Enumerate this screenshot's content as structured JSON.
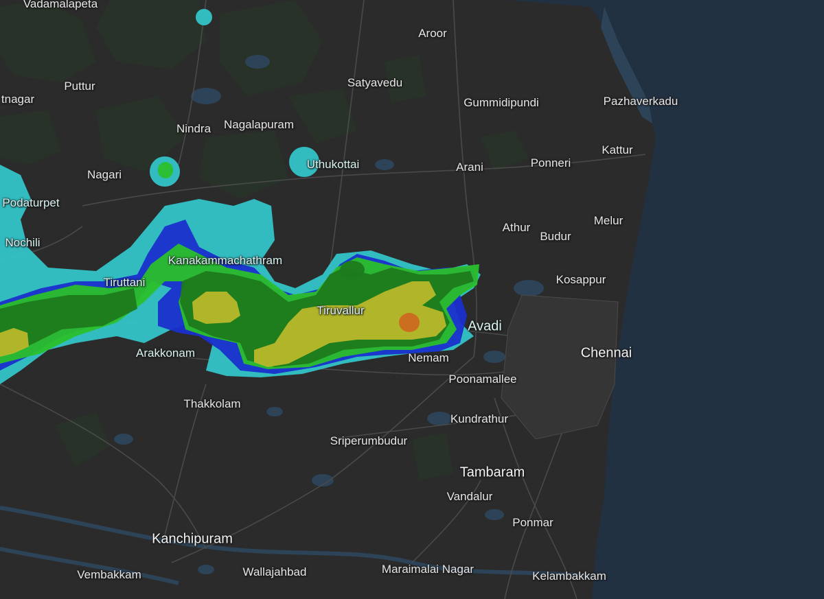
{
  "map": {
    "colors": {
      "land": "#2b2b2b",
      "sea": "#223142",
      "water": "#2d4358",
      "forest": "#283328",
      "road": "#4a4a4a",
      "radar_light": "#33c4c8",
      "radar_blue": "#1a2fcc",
      "radar_green": "#2bbf2b",
      "radar_dark_green": "#1e7a1e",
      "radar_yellow": "#b8b82a",
      "radar_orange": "#cc6a20"
    },
    "places": [
      {
        "id": "vadamalapeta",
        "name": "Vadamalapeta",
        "rank": "minor"
      },
      {
        "id": "aroor",
        "name": "Aroor",
        "rank": "minor"
      },
      {
        "id": "puttur",
        "name": "Puttur",
        "rank": "minor"
      },
      {
        "id": "satyavedu",
        "name": "Satyavedu",
        "rank": "minor"
      },
      {
        "id": "tnagar",
        "name": "tnagar",
        "rank": "minor"
      },
      {
        "id": "gummidipundi",
        "name": "Gummidipundi",
        "rank": "minor"
      },
      {
        "id": "pazhaverkadu",
        "name": "Pazhaverkadu",
        "rank": "minor"
      },
      {
        "id": "nindra",
        "name": "Nindra",
        "rank": "minor"
      },
      {
        "id": "nagalapuram",
        "name": "Nagalapuram",
        "rank": "minor"
      },
      {
        "id": "kattur",
        "name": "Kattur",
        "rank": "minor"
      },
      {
        "id": "uthukottai",
        "name": "Uthukottai",
        "rank": "minor"
      },
      {
        "id": "nagari",
        "name": "Nagari",
        "rank": "minor"
      },
      {
        "id": "arani",
        "name": "Arani",
        "rank": "minor"
      },
      {
        "id": "ponneri",
        "name": "Ponneri",
        "rank": "minor"
      },
      {
        "id": "podaturpet",
        "name": "Podaturpet",
        "rank": "minor"
      },
      {
        "id": "melur",
        "name": "Melur",
        "rank": "minor"
      },
      {
        "id": "athur",
        "name": "Athur",
        "rank": "minor"
      },
      {
        "id": "budur",
        "name": "Budur",
        "rank": "minor"
      },
      {
        "id": "nochili",
        "name": "Nochili",
        "rank": "minor"
      },
      {
        "id": "kanakammachathram",
        "name": "Kanakammachathram",
        "rank": "minor"
      },
      {
        "id": "kosappur",
        "name": "Kosappur",
        "rank": "minor"
      },
      {
        "id": "tiruttani",
        "name": "Tiruttani",
        "rank": "minor"
      },
      {
        "id": "tiruvallur",
        "name": "Tiruvallur",
        "rank": "minor"
      },
      {
        "id": "avadi",
        "name": "Avadi",
        "rank": "major"
      },
      {
        "id": "arakkonam",
        "name": "Arakkonam",
        "rank": "minor"
      },
      {
        "id": "chennai",
        "name": "Chennai",
        "rank": "major"
      },
      {
        "id": "nemam",
        "name": "Nemam",
        "rank": "minor"
      },
      {
        "id": "poonamallee",
        "name": "Poonamallee",
        "rank": "minor"
      },
      {
        "id": "thakkolam",
        "name": "Thakkolam",
        "rank": "minor"
      },
      {
        "id": "kundrathur",
        "name": "Kundrathur",
        "rank": "minor"
      },
      {
        "id": "sriperumbudur",
        "name": "Sriperumbudur",
        "rank": "minor"
      },
      {
        "id": "tambaram",
        "name": "Tambaram",
        "rank": "major"
      },
      {
        "id": "vandalur",
        "name": "Vandalur",
        "rank": "minor"
      },
      {
        "id": "ponmar",
        "name": "Ponmar",
        "rank": "minor"
      },
      {
        "id": "kanchipuram",
        "name": "Kanchipuram",
        "rank": "major"
      },
      {
        "id": "vembakkam",
        "name": "Vembakkam",
        "rank": "minor"
      },
      {
        "id": "wallajahbad",
        "name": "Wallajahbad",
        "rank": "minor"
      },
      {
        "id": "maraimalai-nagar",
        "name": "Maraimalai Nagar",
        "rank": "minor"
      },
      {
        "id": "kelambakkam",
        "name": "Kelambakkam",
        "rank": "minor"
      }
    ]
  }
}
